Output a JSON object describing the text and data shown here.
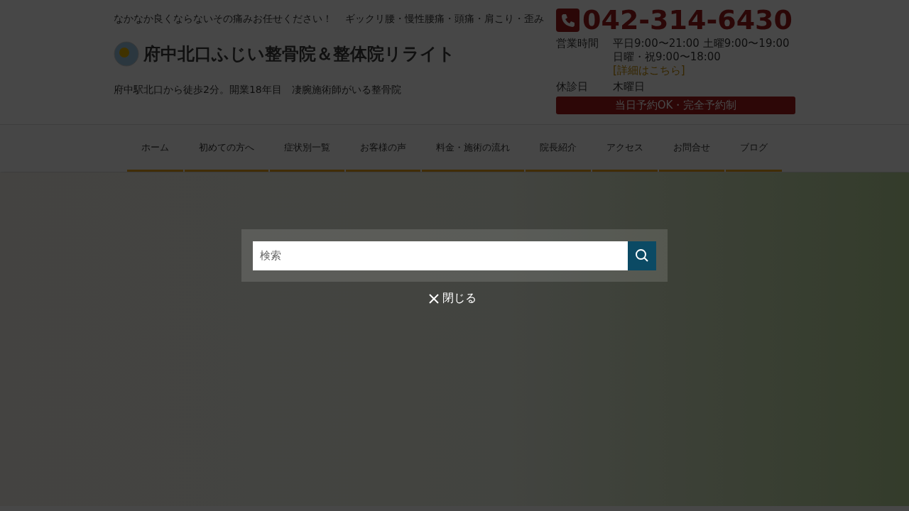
{
  "header": {
    "tagline": "なかなか良くならないその痛みお任せください！　 ギックリ腰・慢性腰痛・頭痛・肩こり・歪み",
    "logo": "府中北口ふじい整骨院＆整体院リライト",
    "subtitle": "府中駅北口から徒歩2分。開業18年目　凄腕施術師がいる整骨院",
    "phone": "042-314-6430",
    "info": [
      {
        "label": "営業時間",
        "value": "平日9:00〜21:00 土曜9:00〜19:00 日曜・祝9:00〜18:00",
        "link": "[詳細はこちら]"
      },
      {
        "label": "休診日",
        "value": "木曜日"
      }
    ],
    "notice": "当日予約OK・完全予約制"
  },
  "nav": [
    "ホーム",
    "初めての方へ",
    "症状別一覧",
    "お客様の声",
    "料金・施術の流れ",
    "院長紹介",
    "アクセス",
    "お問合せ",
    "ブログ"
  ],
  "search": {
    "placeholder": "検索",
    "close": "閉じる"
  }
}
